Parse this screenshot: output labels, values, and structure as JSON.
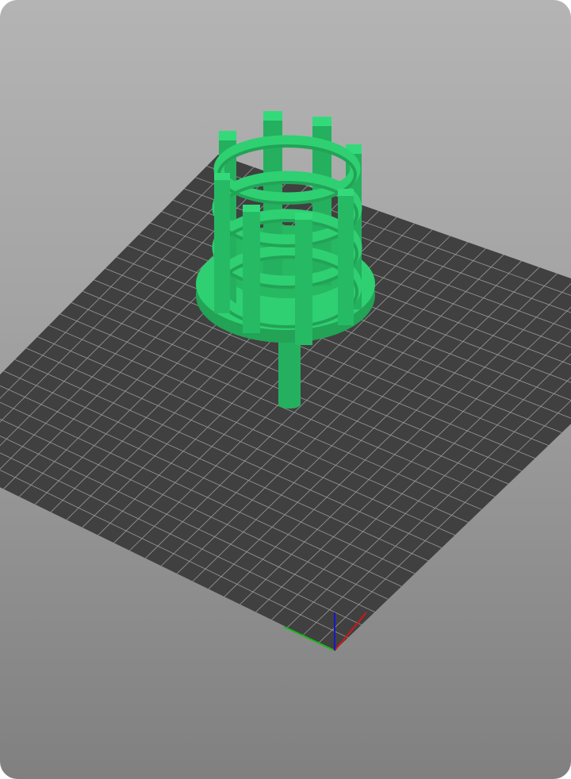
{
  "viewport": {
    "colors": {
      "background_top": "#b4b4b4",
      "background_bottom": "#808080",
      "bed": "#404040",
      "grid": "#9a9a9a",
      "model": "#2fd072",
      "model_shade": "#22a356",
      "axis_x": "#d01818",
      "axis_y": "#18b818",
      "axis_z": "#1818c8"
    },
    "grid_divisions": 26
  }
}
